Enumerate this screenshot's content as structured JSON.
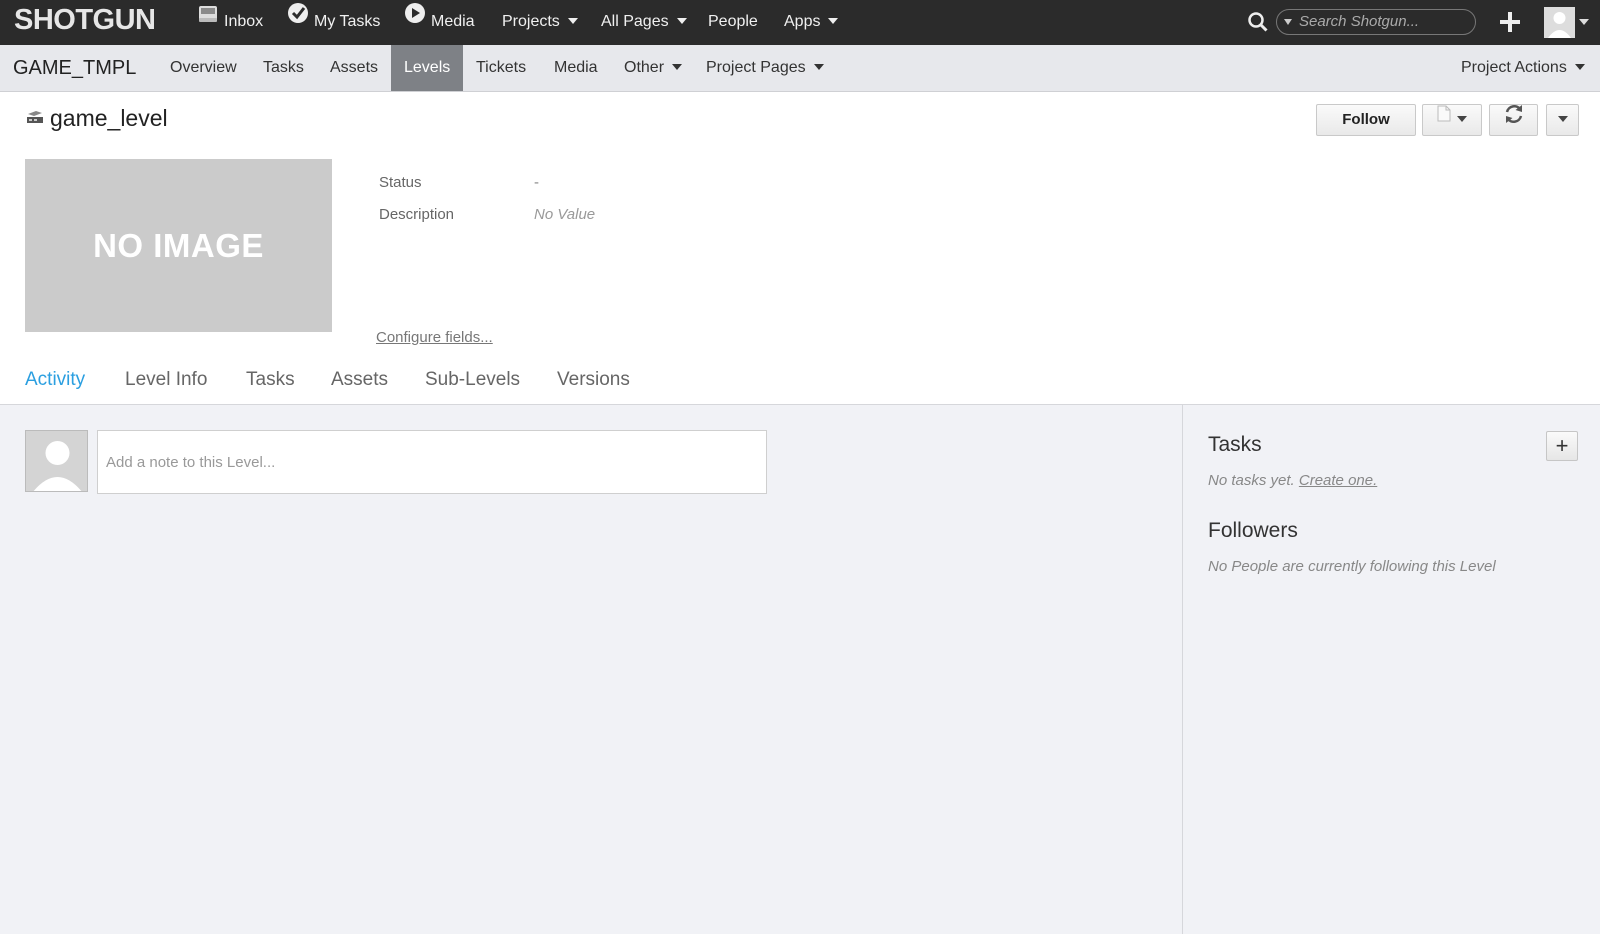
{
  "topbar": {
    "logo": "SHOTGUN",
    "nav": [
      {
        "label": "Inbox",
        "icon": "inbox-icon"
      },
      {
        "label": "My Tasks",
        "icon": "checkmark-icon"
      },
      {
        "label": "Media",
        "icon": "play-icon"
      },
      {
        "label": "Projects",
        "dropdown": true
      },
      {
        "label": "All Pages",
        "dropdown": true
      },
      {
        "label": "People"
      },
      {
        "label": "Apps",
        "dropdown": true
      }
    ],
    "search_placeholder": "Search Shotgun..."
  },
  "project": {
    "name": "GAME_TMPL",
    "tabs": [
      "Overview",
      "Tasks",
      "Assets",
      "Levels",
      "Tickets",
      "Media",
      "Other",
      "Project Pages"
    ],
    "active_tab": "Levels",
    "actions_label": "Project Actions"
  },
  "entity": {
    "title": "game_level",
    "icon": "level-icon",
    "follow_label": "Follow",
    "no_image_text": "NO IMAGE",
    "fields": {
      "status_label": "Status",
      "status_value": "-",
      "description_label": "Description",
      "description_value": "No Value"
    },
    "configure_link": "Configure fields..."
  },
  "subtabs": [
    "Activity",
    "Level Info",
    "Tasks",
    "Assets",
    "Sub-Levels",
    "Versions"
  ],
  "active_subtab": "Activity",
  "activity": {
    "note_placeholder": "Add a note to this Level..."
  },
  "sidebar": {
    "tasks_heading": "Tasks",
    "tasks_empty": "No tasks yet.",
    "tasks_create_link": "Create one.",
    "followers_heading": "Followers",
    "followers_empty": "No People are currently following this Level"
  },
  "colors": {
    "topbar_bg": "#2b2b2b",
    "active_tab_bg": "#7e8186",
    "accent": "#2b9fe0"
  }
}
